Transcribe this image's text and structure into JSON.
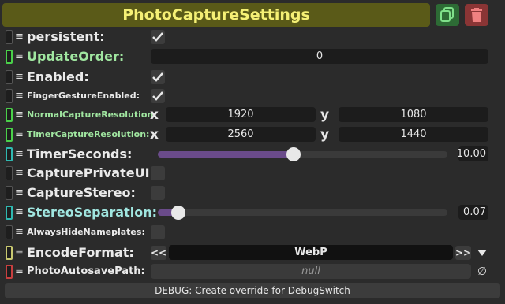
{
  "header": {
    "title": "PhotoCaptureSettings",
    "duplicate_icon": "duplicate-icon",
    "delete_icon": "trash-icon",
    "title_color": "#f5f075",
    "title_bg": "#5a5a18"
  },
  "fields": {
    "persistent": {
      "label": "persistent:",
      "checked": true
    },
    "update_order": {
      "label": "UpdateOrder:",
      "value": "0"
    },
    "enabled": {
      "label": "Enabled:",
      "checked": true
    },
    "finger_gesture": {
      "label": "FingerGestureEnabled:",
      "checked": true
    },
    "normal_res": {
      "label": "NormalCaptureResolution:",
      "x_axis": "x",
      "x": "1920",
      "y_axis": "y",
      "y": "1080"
    },
    "timer_res": {
      "label": "TimerCaptureResolution:",
      "x_axis": "x",
      "x": "2560",
      "y_axis": "y",
      "y": "1440"
    },
    "timer_seconds": {
      "label": "TimerSeconds:",
      "value": "10.00",
      "fraction": 0.47
    },
    "capture_private_ui": {
      "label": "CapturePrivateUI:",
      "checked": false
    },
    "capture_stereo": {
      "label": "CaptureStereo:",
      "checked": false
    },
    "stereo_separation": {
      "label": "StereoSeparation:",
      "value": "0.07",
      "fraction": 0.07
    },
    "always_hide_nameplates": {
      "label": "AlwaysHideNameplates:",
      "checked": false
    },
    "encode_format": {
      "label": "EncodeFormat:",
      "value": "WebP",
      "prev": "<<",
      "next": ">>"
    },
    "photo_autosave_path": {
      "label": "PhotoAutosavePath:",
      "value": "null",
      "clear": "∅"
    }
  },
  "footer": {
    "text": "DEBUG: Create override for DebugSwitch"
  },
  "colors": {
    "slider_fill": "#6a4b8a",
    "handle_green": "#4ad04a",
    "handle_teal": "#2fb8b0",
    "handle_yellow": "#c8c870",
    "handle_red": "#c84040"
  }
}
